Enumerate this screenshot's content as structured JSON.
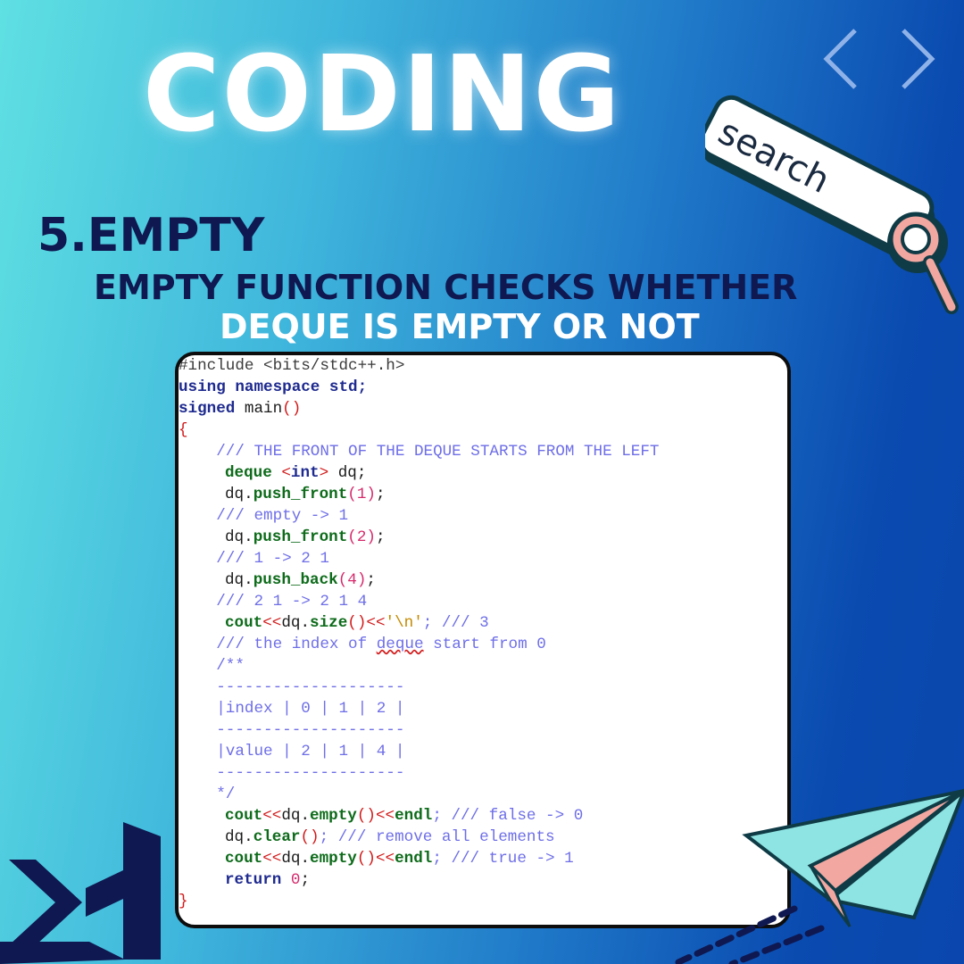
{
  "title": "CODING",
  "section": {
    "heading": "5.EMPTY",
    "desc_line1": "EMPTY FUNCTION CHECKS WHETHER",
    "desc_line2": "DEQUE IS EMPTY OR NOT"
  },
  "search_bar": {
    "label": "search"
  },
  "icons": {
    "code_brackets": "chevron-left-right-icon",
    "search": "magnifier-icon",
    "paper_plane": "paper-plane-icon",
    "logo": "visual-studio-logo"
  },
  "colors": {
    "dark_navy": "#0f1850",
    "white": "#ffffff",
    "plane_teal": "#8ee4e2",
    "plane_pink": "#f2a7a0"
  },
  "code": {
    "line1": "#include <bits/stdc++.h>",
    "line2_kw": "using namespace",
    "line2_rest": " std;",
    "line3_kw": "signed",
    "line3_rest": " main",
    "line3_paren": "()",
    "line4": "{",
    "c1": "    /// THE FRONT OF THE DEQUE STARTS FROM THE LEFT",
    "d1_type": "deque",
    "d1_lt": " <",
    "d1_int": "int",
    "d1_gt": ">",
    "d1_rest": " dq;",
    "pf1_obj": "dq.",
    "pf1_fn": "push_front",
    "pf1_args": "(1)",
    "pf1_end": ";",
    "c2": "    /// empty -> 1",
    "pf2_obj": "dq.",
    "pf2_fn": "push_front",
    "pf2_args": "(2)",
    "pf2_end": ";",
    "c3": "    /// 1 -> 2 1",
    "pb_obj": "dq.",
    "pb_fn": "push_back",
    "pb_args": "(4)",
    "pb_end": ";",
    "c4": "    /// 2 1 -> 2 1 4",
    "size_cout": "cout",
    "size_op": "<<",
    "size_obj": "dq.",
    "size_fn": "size",
    "size_paren": "()",
    "size_op2": "<<",
    "size_str": "'\\n'",
    "size_cm": "; /// 3",
    "c5a": "    /// the index of ",
    "c5b": "deque",
    "c5c": " start from 0",
    "c6": "    /**",
    "c7": "    --------------------",
    "c8": "    |index | 0 | 1 | 2 |",
    "c9": "    --------------------",
    "c10": "    |value | 2 | 1 | 4 |",
    "c11": "    --------------------",
    "c12": "    */",
    "e1_cout": "cout",
    "e1_op": "<<",
    "e1_obj": "dq.",
    "e1_fn": "empty",
    "e1_paren": "()",
    "e1_op2": "<<",
    "e1_endl": "endl",
    "e1_cm": "; /// false -> 0",
    "cl_obj": "dq.",
    "cl_fn": "clear",
    "cl_paren": "()",
    "cl_cm": "; /// remove all elements",
    "e2_cout": "cout",
    "e2_op": "<<",
    "e2_obj": "dq.",
    "e2_fn": "empty",
    "e2_paren": "()",
    "e2_op2": "<<",
    "e2_endl": "endl",
    "e2_cm": "; /// true -> 1",
    "ret_kw": "return",
    "ret_num": " 0",
    "ret_end": ";",
    "close": "}"
  }
}
